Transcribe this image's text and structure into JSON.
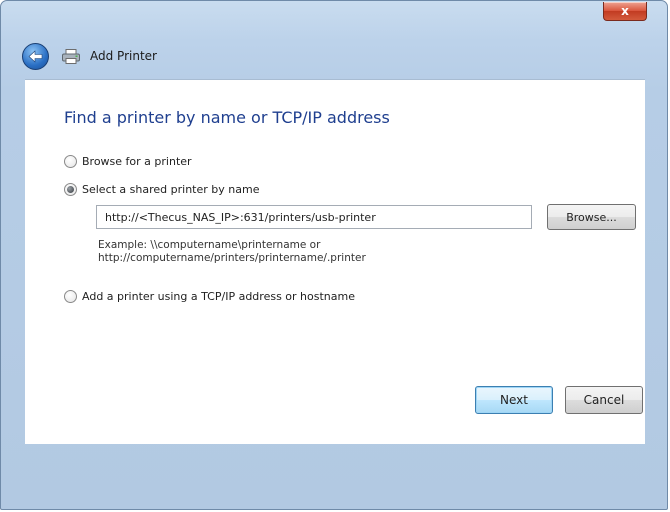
{
  "window": {
    "title": "Add Printer",
    "close_glyph": "x"
  },
  "page": {
    "heading": "Find a printer by name or TCP/IP address"
  },
  "options": {
    "browse": {
      "label": "Browse for a printer",
      "checked": false
    },
    "shared": {
      "label": "Select a shared printer by name",
      "checked": true
    },
    "tcpip": {
      "label": "Add a printer using a TCP/IP address or hostname",
      "checked": false
    }
  },
  "shared_input": {
    "value": "http://<Thecus_NAS_IP>:631/printers/usb-printer"
  },
  "browse_button": {
    "label": "Browse..."
  },
  "example": {
    "line1": "Example: \\\\computername\\printername or",
    "line2": "http://computername/printers/printername/.printer"
  },
  "footer": {
    "next_label": "Next",
    "cancel_label": "Cancel"
  },
  "colors": {
    "heading": "#1f3f8f",
    "window_frame": "#b6cde6",
    "close_button": "#c9452c"
  },
  "icons": {
    "back": "back-arrow-icon",
    "printer": "printer-icon",
    "close": "close-icon"
  }
}
